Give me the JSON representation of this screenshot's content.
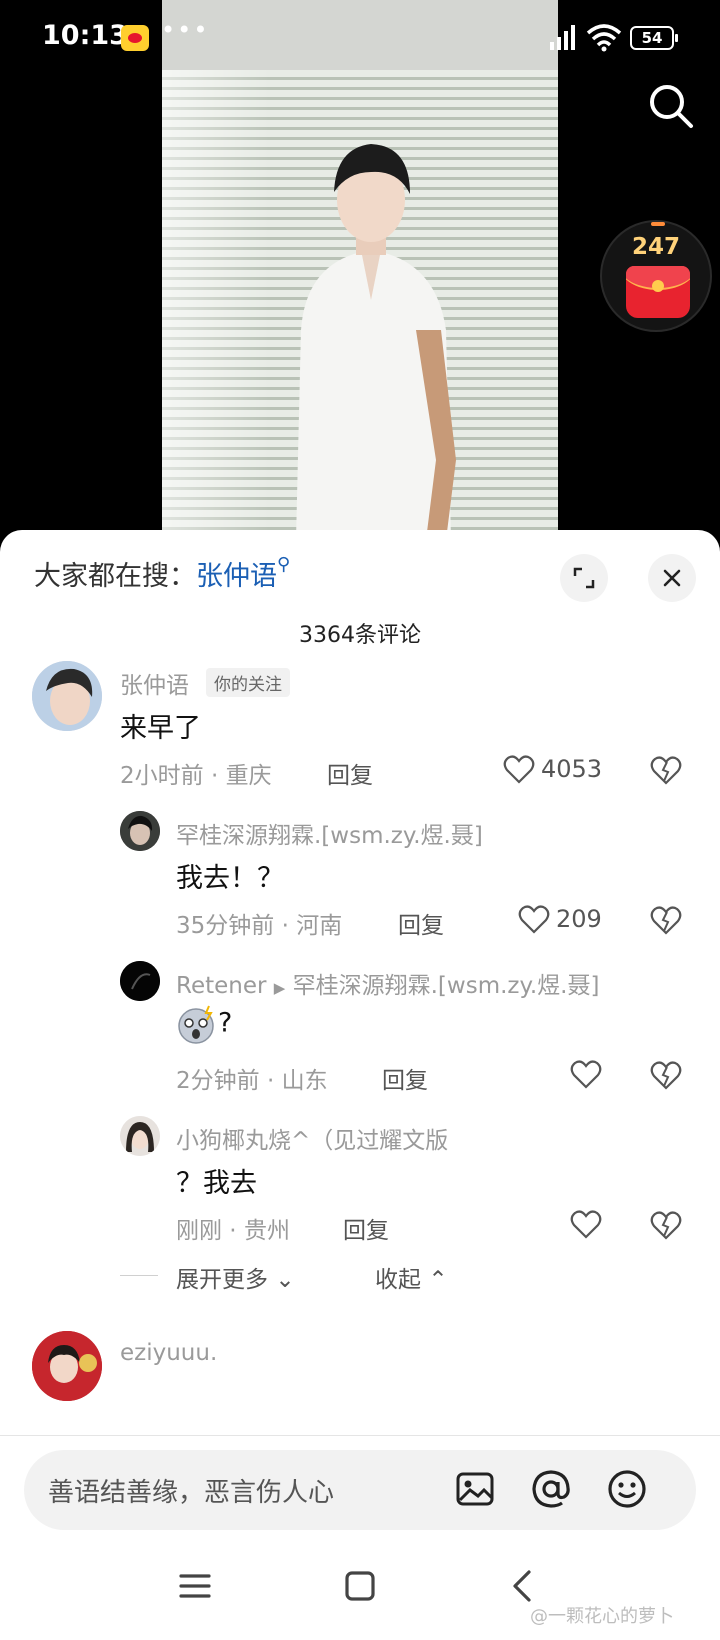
{
  "status": {
    "time": "10:13",
    "battery": "54"
  },
  "video": {
    "redpack_count": "247"
  },
  "sheet": {
    "trending_label": "大家都在搜：",
    "trending_keyword": "张仲语",
    "comment_count_label": "3364条评论"
  },
  "comment": {
    "username": "张仲语",
    "tag": "你的关注",
    "text": "来早了",
    "time": "2小时前",
    "location": "重庆",
    "reply": "回复",
    "likes": "4053",
    "replies": [
      {
        "username": "罕桂深源翔霖.[wsm.zy.煜.聂]",
        "text": "我去！？",
        "time": "35分钟前",
        "location": "河南",
        "reply": "回复",
        "likes": "209"
      },
      {
        "username": "Retener",
        "reply_to": "罕桂深源翔霖.[wsm.zy.煜.聂]",
        "text": "?",
        "time": "2分钟前",
        "location": "山东",
        "reply": "回复",
        "likes": ""
      },
      {
        "username": "小狗椰丸烧^（见过耀文版",
        "text": "？我去",
        "time": "刚刚",
        "location": "贵州",
        "reply": "回复",
        "likes": ""
      }
    ],
    "expand_more": "展开更多",
    "collapse": "收起"
  },
  "next_comment": {
    "username": "eziyuuu."
  },
  "input": {
    "placeholder": "善语结善缘，恶言伤人心"
  },
  "watermark": "@一颗花心的萝卜",
  "colors": {
    "accent": "#1b5fb4",
    "red": "#e8232f"
  }
}
